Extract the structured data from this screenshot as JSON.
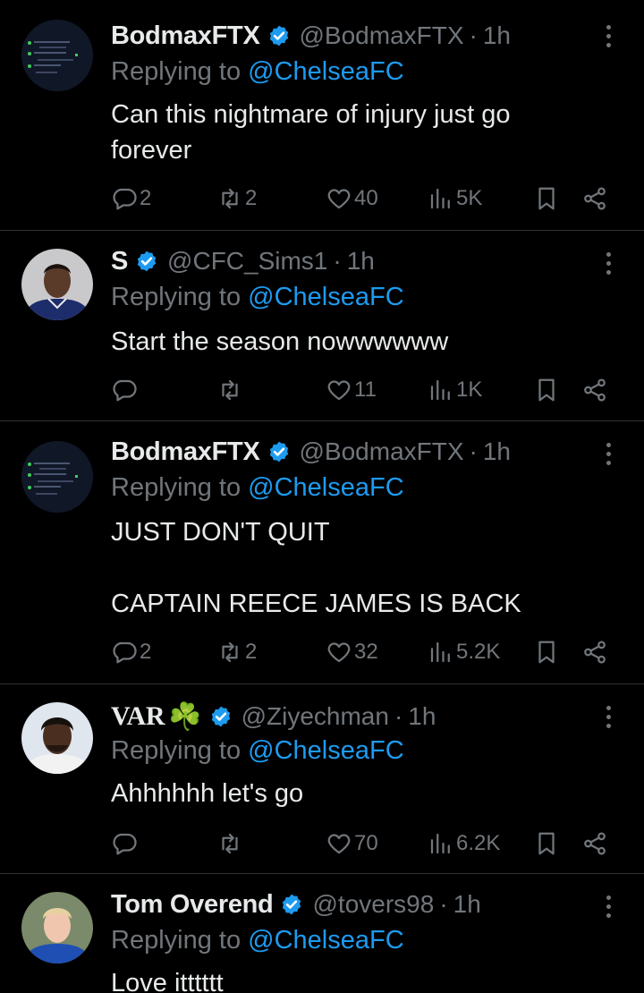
{
  "tweets": [
    {
      "name": "BodmaxFTX",
      "handle": "@BodmaxFTX",
      "time": "1h",
      "reply_prefix": "Replying to",
      "reply_to": "@ChelseaFC",
      "body": "Can this nightmare of injury just go\nforever",
      "replies": "2",
      "reposts": "2",
      "likes": "40",
      "views": "5K"
    },
    {
      "name": "S",
      "handle": "@CFC_Sims1",
      "time": "1h",
      "reply_prefix": "Replying to",
      "reply_to": "@ChelseaFC",
      "body": "Start the season nowwwwww",
      "replies": "",
      "reposts": "",
      "likes": "11",
      "views": "1K"
    },
    {
      "name": "BodmaxFTX",
      "handle": "@BodmaxFTX",
      "time": "1h",
      "reply_prefix": "Replying to",
      "reply_to": "@ChelseaFC",
      "body": "JUST DON'T QUIT\n\nCAPTAIN REECE JAMES IS BACK",
      "replies": "2",
      "reposts": "2",
      "likes": "32",
      "views": "5.2K"
    },
    {
      "name": "VAR",
      "name_emoji": "☘️",
      "handle": "@Ziyechman",
      "time": "1h",
      "reply_prefix": "Replying to",
      "reply_to": "@ChelseaFC",
      "body": "Ahhhhhh let's go",
      "replies": "",
      "reposts": "",
      "likes": "70",
      "views": "6.2K"
    },
    {
      "name": "Tom Overend",
      "handle": "@tovers98",
      "time": "1h",
      "reply_prefix": "Replying to",
      "reply_to": "@ChelseaFC",
      "body": "Love itttttt"
    }
  ],
  "separator": "·",
  "colors": {
    "background": "#000000",
    "text": "#e7e9ea",
    "muted": "#71767b",
    "accent": "#1d9bf0",
    "divider": "#2f3336"
  },
  "icons": [
    "reply-icon",
    "repost-icon",
    "like-icon",
    "views-icon",
    "bookmark-icon",
    "share-icon",
    "more-icon",
    "verified-badge-icon"
  ]
}
